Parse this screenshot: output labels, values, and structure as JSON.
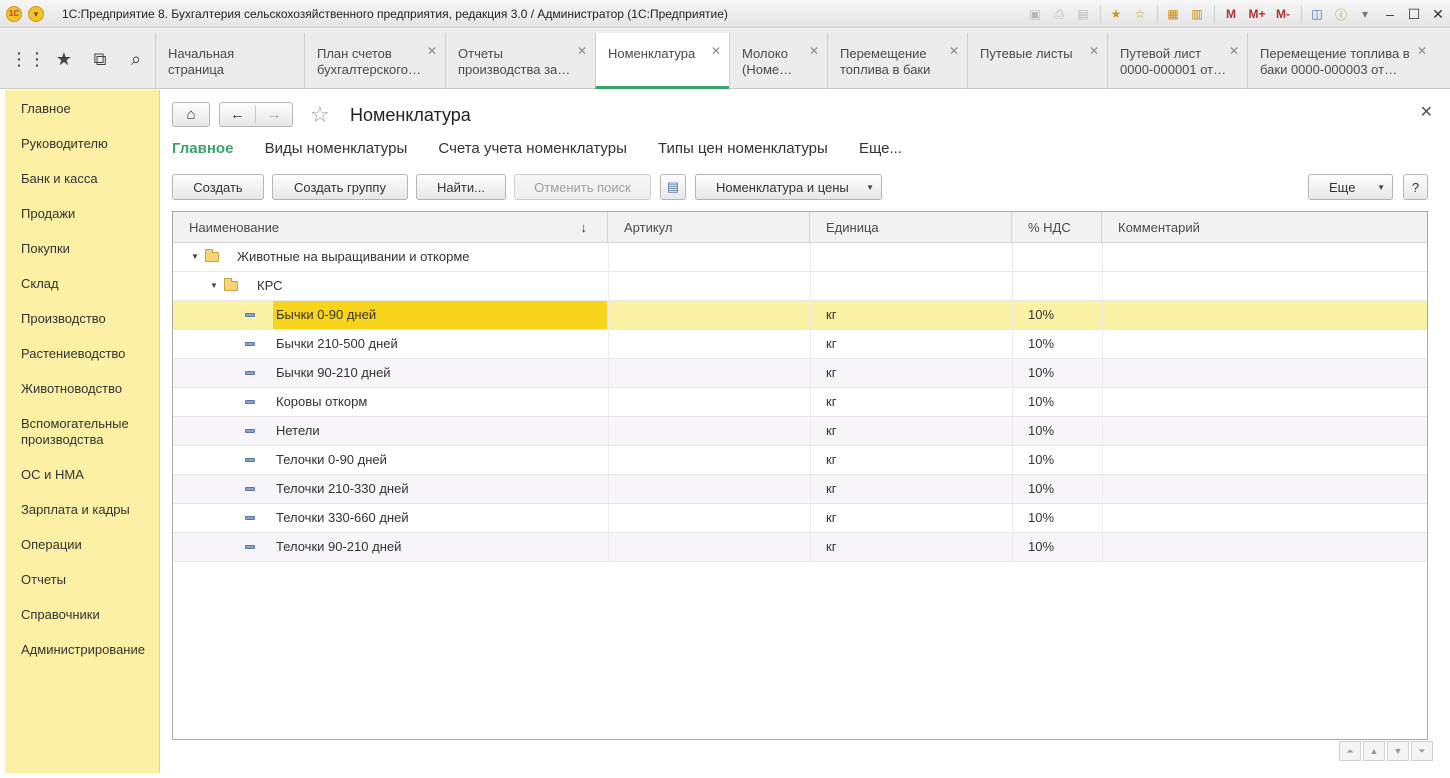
{
  "window": {
    "title": "1С:Предприятие 8. Бухгалтерия сельскохозяйственного предприятия, редакция 3.0 / Администратор  (1С:Предприятие)",
    "logo_text": "1С",
    "memory_buttons": [
      "M",
      "M+",
      "M-"
    ]
  },
  "tabs": [
    {
      "label": "Начальная страница",
      "closable": false
    },
    {
      "label": "План счетов бухгалтерского…",
      "closable": true
    },
    {
      "label": "Отчеты производства за…",
      "closable": true
    },
    {
      "label": "Номенклатура",
      "closable": true,
      "active": true
    },
    {
      "label": "Молоко (Номе…",
      "closable": true
    },
    {
      "label": "Перемещение топлива в баки",
      "closable": true
    },
    {
      "label": "Путевые листы",
      "closable": true
    },
    {
      "label": "Путевой лист 0000-000001 от…",
      "closable": true
    },
    {
      "label": "Перемещение топлива в баки 0000-000003 от…",
      "closable": true
    }
  ],
  "sidebar": {
    "items": [
      "Главное",
      "Руководителю",
      "Банк и касса",
      "Продажи",
      "Покупки",
      "Склад",
      "Производство",
      "Растениеводство",
      "Животноводство",
      "Вспомогательные производства",
      "ОС и НМА",
      "Зарплата и кадры",
      "Операции",
      "Отчеты",
      "Справочники",
      "Администрирование"
    ]
  },
  "form": {
    "title": "Номенклатура",
    "nav_links": [
      "Главное",
      "Виды номенклатуры",
      "Счета учета номенклатуры",
      "Типы цен номенклатуры",
      "Еще..."
    ],
    "toolbar": {
      "create": "Создать",
      "create_group": "Создать группу",
      "find": "Найти...",
      "cancel_search": "Отменить поиск",
      "nomenclature_prices": "Номенклатура и цены",
      "more": "Еще",
      "help": "?"
    }
  },
  "table": {
    "columns": [
      "Наименование",
      "Артикул",
      "Единица",
      "% НДС",
      "Комментарий"
    ],
    "sort_indicator": "↓",
    "groups": [
      {
        "label": "Животные на выращивании и откорме",
        "level": 0
      },
      {
        "label": "КРС",
        "level": 1
      }
    ],
    "rows": [
      {
        "name": "Бычки 0-90 дней",
        "article": "",
        "unit": "кг",
        "vat": "10%",
        "comment": "",
        "selected": true
      },
      {
        "name": "Бычки 210-500 дней",
        "article": "",
        "unit": "кг",
        "vat": "10%",
        "comment": ""
      },
      {
        "name": "Бычки 90-210 дней",
        "article": "",
        "unit": "кг",
        "vat": "10%",
        "comment": ""
      },
      {
        "name": "Коровы откорм",
        "article": "",
        "unit": "кг",
        "vat": "10%",
        "comment": ""
      },
      {
        "name": "Нетели",
        "article": "",
        "unit": "кг",
        "vat": "10%",
        "comment": ""
      },
      {
        "name": "Телочки 0-90 дней",
        "article": "",
        "unit": "кг",
        "vat": "10%",
        "comment": ""
      },
      {
        "name": "Телочки 210-330 дней",
        "article": "",
        "unit": "кг",
        "vat": "10%",
        "comment": ""
      },
      {
        "name": "Телочки 330-660 дней",
        "article": "",
        "unit": "кг",
        "vat": "10%",
        "comment": ""
      },
      {
        "name": "Телочки 90-210 дней",
        "article": "",
        "unit": "кг",
        "vat": "10%",
        "comment": ""
      }
    ]
  },
  "colors": {
    "accent": "#3aa36a",
    "sidebar_bg": "#fcf0a4",
    "selected_row": "#fbf2a6",
    "selected_cell": "#f9d41d"
  }
}
